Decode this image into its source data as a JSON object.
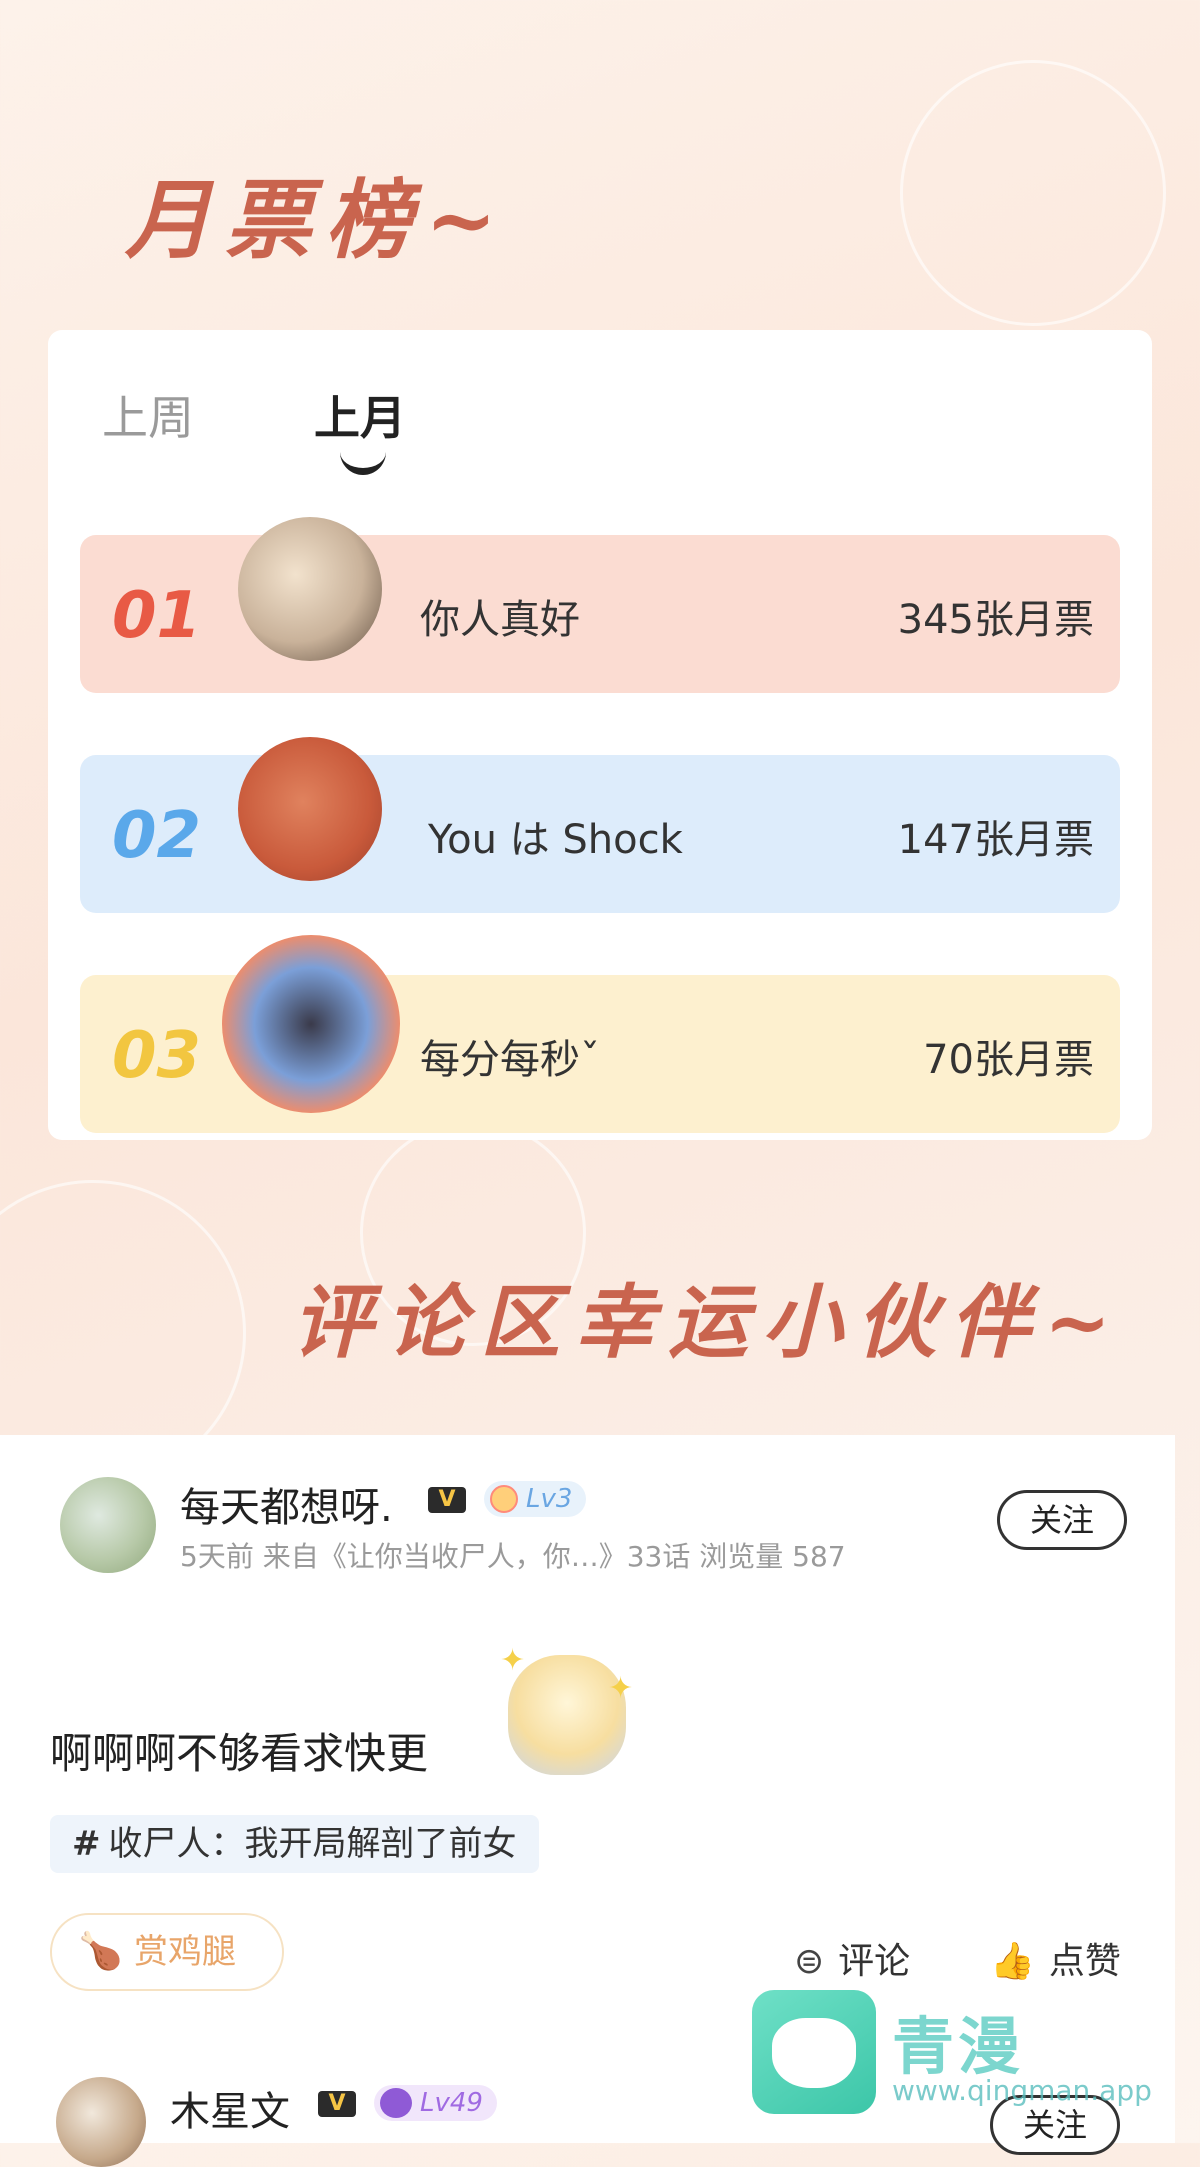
{
  "sections": {
    "monthly_title": "月票榜~",
    "lucky_title": "评论区幸运小伙伴~"
  },
  "ranking": {
    "tabs": [
      "上周",
      "上月"
    ],
    "active_tab": "上月",
    "rows": [
      {
        "rank": "01",
        "name": "你人真好",
        "votes": "345张月票"
      },
      {
        "rank": "02",
        "name": "You は Shock",
        "votes": "147张月票"
      },
      {
        "rank": "03",
        "name": "每分每秒ˇ",
        "votes": "70张月票"
      }
    ]
  },
  "post": {
    "username": "每天都想呀.",
    "v_badge": "V",
    "level": "Lv3",
    "meta": "5天前 来自《让你当收尸人，你…》33话  浏览量 587",
    "follow": "关注",
    "body": "啊啊啊不够看求快更",
    "topic": "收尸人：我开局解剖了前女",
    "topic_hash": "#",
    "reward": "赏鸡腿",
    "comment": "评论",
    "like": "点赞"
  },
  "post2": {
    "username": "木星文",
    "v_badge": "V",
    "level": "Lv49",
    "follow": "关注"
  },
  "watermark": {
    "name": "青漫",
    "url": "www.qingman.app"
  },
  "colors": {
    "title": "#c9644e",
    "rank1": "#e85a45",
    "rank2": "#5aa8ea",
    "rank3": "#f2c640"
  }
}
